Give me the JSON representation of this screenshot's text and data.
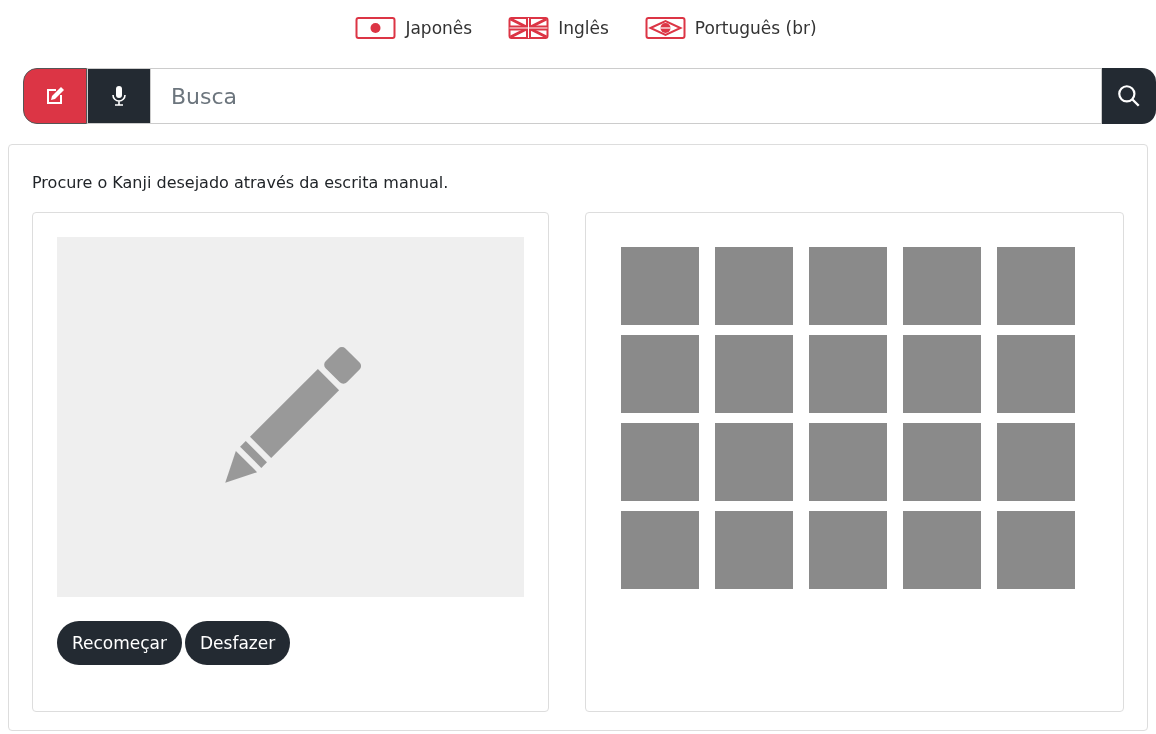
{
  "languages": [
    {
      "label": "Japonês",
      "kind": "japan"
    },
    {
      "label": "Inglês",
      "kind": "uk"
    },
    {
      "label": "Português (br)",
      "kind": "brazil"
    }
  ],
  "search": {
    "modes": [
      {
        "kind": "handwriting",
        "selected": true
      },
      {
        "kind": "voice",
        "selected": false
      }
    ],
    "placeholder": "Busca"
  },
  "instruction": "Procure o Kanji desejado através da escrita manual.",
  "drawing_pad": {
    "buttons": [
      "Recomeçar",
      "Desfazer"
    ]
  },
  "candidates": [
    {
      "kind": "empty"
    },
    {
      "kind": "empty"
    },
    {
      "kind": "empty"
    },
    {
      "kind": "empty"
    },
    {
      "kind": "empty"
    },
    {
      "kind": "empty"
    },
    {
      "kind": "empty"
    },
    {
      "kind": "empty"
    },
    {
      "kind": "empty"
    },
    {
      "kind": "empty"
    },
    {
      "kind": "empty"
    },
    {
      "kind": "empty"
    },
    {
      "kind": "empty"
    },
    {
      "kind": "empty"
    },
    {
      "kind": "empty"
    },
    {
      "kind": "empty"
    },
    {
      "kind": "empty"
    },
    {
      "kind": "empty"
    },
    {
      "kind": "empty"
    },
    {
      "kind": "empty"
    }
  ]
}
